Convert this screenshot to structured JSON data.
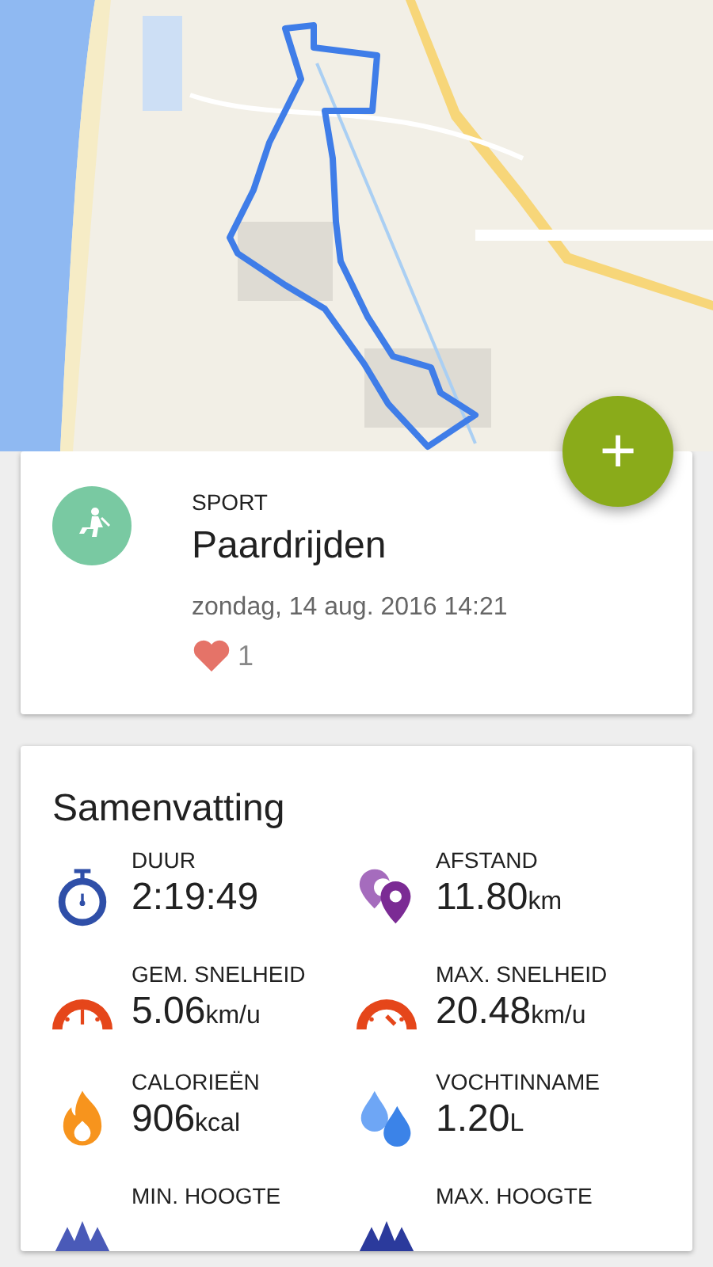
{
  "add_button": {
    "label": "+"
  },
  "activity": {
    "category": "SPORT",
    "name": "Paardrijden",
    "datetime": "zondag, 14 aug. 2016 14:21",
    "likes": "1"
  },
  "summary": {
    "title": "Samenvatting",
    "stats": [
      {
        "kind": "duration",
        "label": "DUUR",
        "value": "2:19:49"
      },
      {
        "kind": "distance",
        "label": "AFSTAND",
        "value": "11.80",
        "unit": "km"
      },
      {
        "kind": "avg_speed",
        "label": "GEM. SNELHEID",
        "value": "5.06",
        "unit": "km/u"
      },
      {
        "kind": "max_speed",
        "label": "MAX. SNELHEID",
        "value": "20.48",
        "unit": "km/u"
      },
      {
        "kind": "calories",
        "label": "CALORIEËN",
        "value": "906",
        "unit": "kcal"
      },
      {
        "kind": "hydration",
        "label": "VOCHTINNAME",
        "value": "1.20",
        "unit": "L"
      },
      {
        "kind": "min_altitude",
        "label": "MIN. HOOGTE"
      },
      {
        "kind": "max_altitude",
        "label": "MAX. HOOGTE"
      }
    ]
  }
}
